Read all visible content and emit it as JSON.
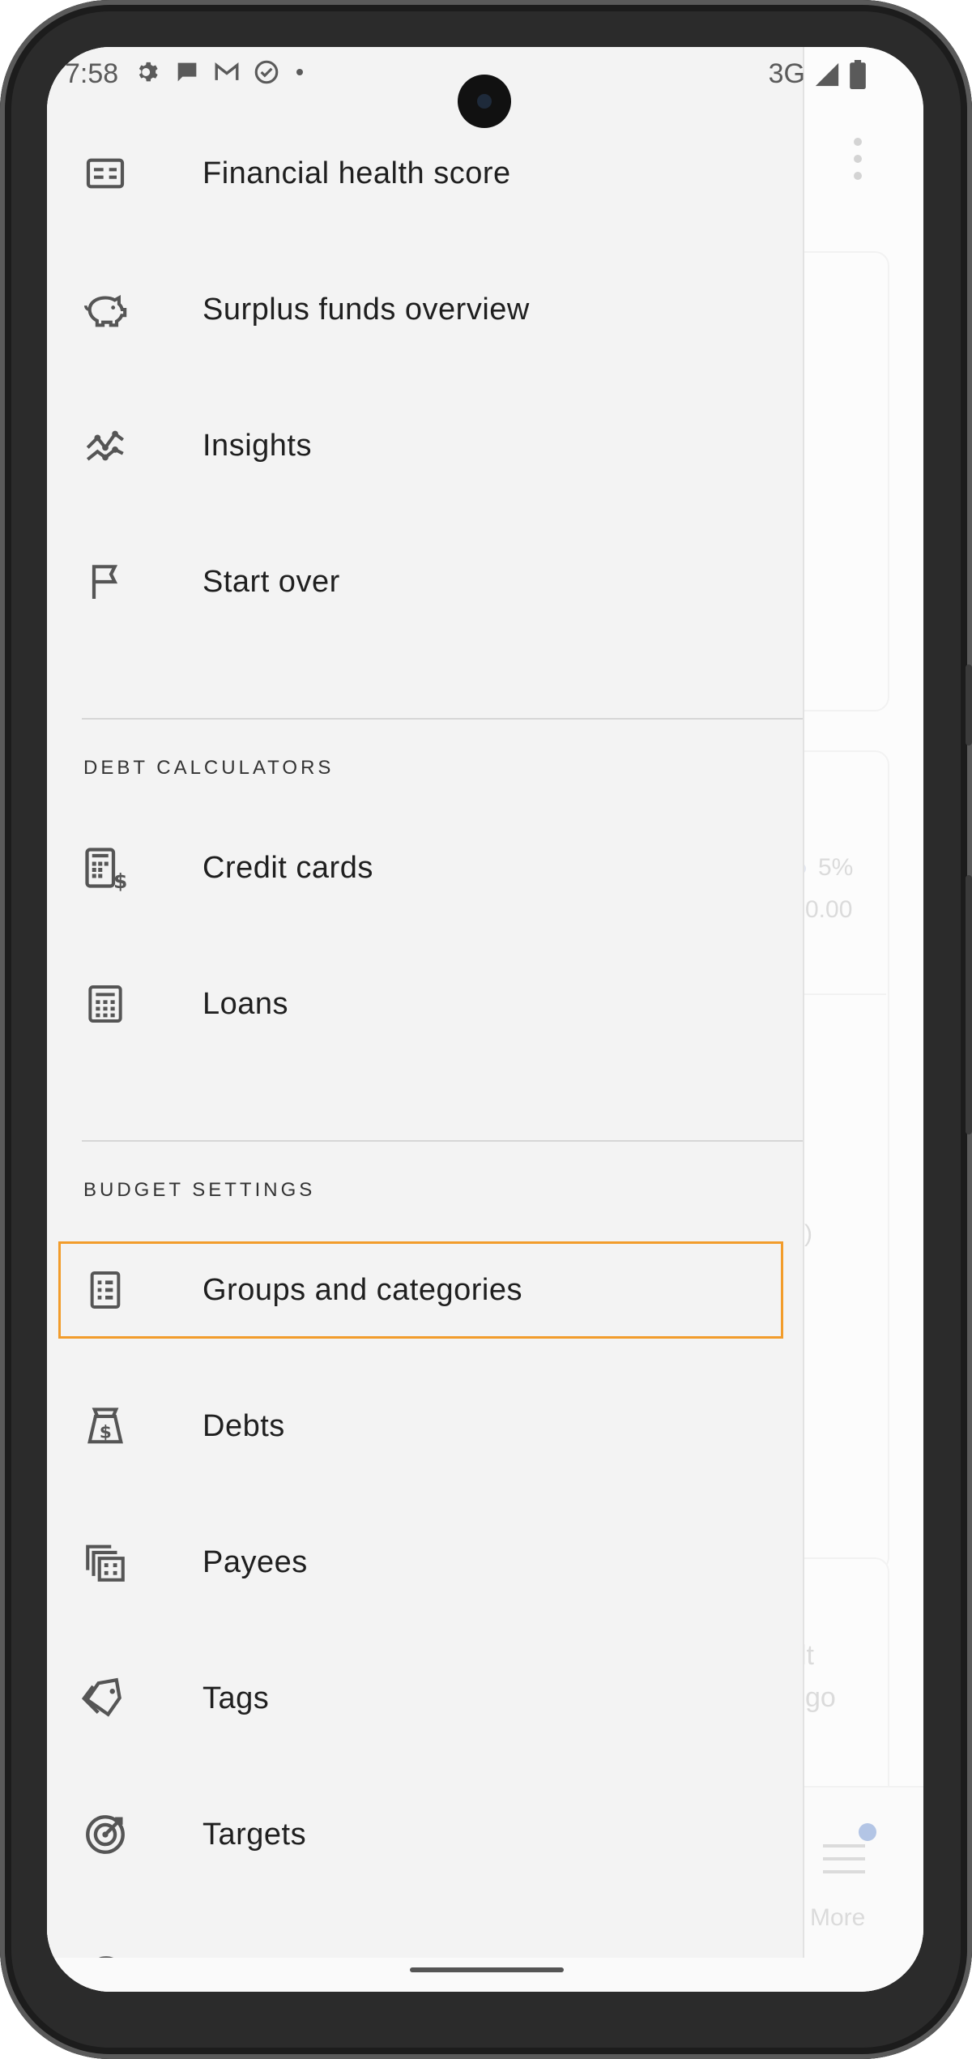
{
  "status_bar": {
    "time": "7:58",
    "network": "3G",
    "notification_icons": [
      "gear-icon",
      "chat-icon",
      "gmail-icon",
      "check-circle-icon",
      "dot-icon"
    ]
  },
  "drawer": {
    "top_items": [
      {
        "label": "Financial health score",
        "icon": "scorecard-icon"
      },
      {
        "label": "Surplus funds overview",
        "icon": "piggy-bank-icon"
      },
      {
        "label": "Insights",
        "icon": "insights-icon"
      },
      {
        "label": "Start over",
        "icon": "flag-icon"
      }
    ],
    "debt_calculators": {
      "header": "DEBT CALCULATORS",
      "items": [
        {
          "label": "Credit cards",
          "icon": "calculator-dollar-icon"
        },
        {
          "label": "Loans",
          "icon": "calculator-icon"
        }
      ]
    },
    "budget_settings": {
      "header": "BUDGET SETTINGS",
      "items": [
        {
          "label": "Groups and categories",
          "icon": "list-sheet-icon",
          "highlighted": true
        },
        {
          "label": "Debts",
          "icon": "money-bag-icon"
        },
        {
          "label": "Payees",
          "icon": "buildings-icon"
        },
        {
          "label": "Tags",
          "icon": "tags-icon"
        },
        {
          "label": "Targets",
          "icon": "target-icon"
        }
      ]
    },
    "highlight_color": "#f29c2b"
  },
  "background_app": {
    "percent_text": "5%",
    "amount_text": "0.00",
    "partial_paren": "s)",
    "partial_text_1": "lt",
    "partial_text_2": "go",
    "bottom_nav_more": "More",
    "badge_color": "#8aa7d8"
  }
}
